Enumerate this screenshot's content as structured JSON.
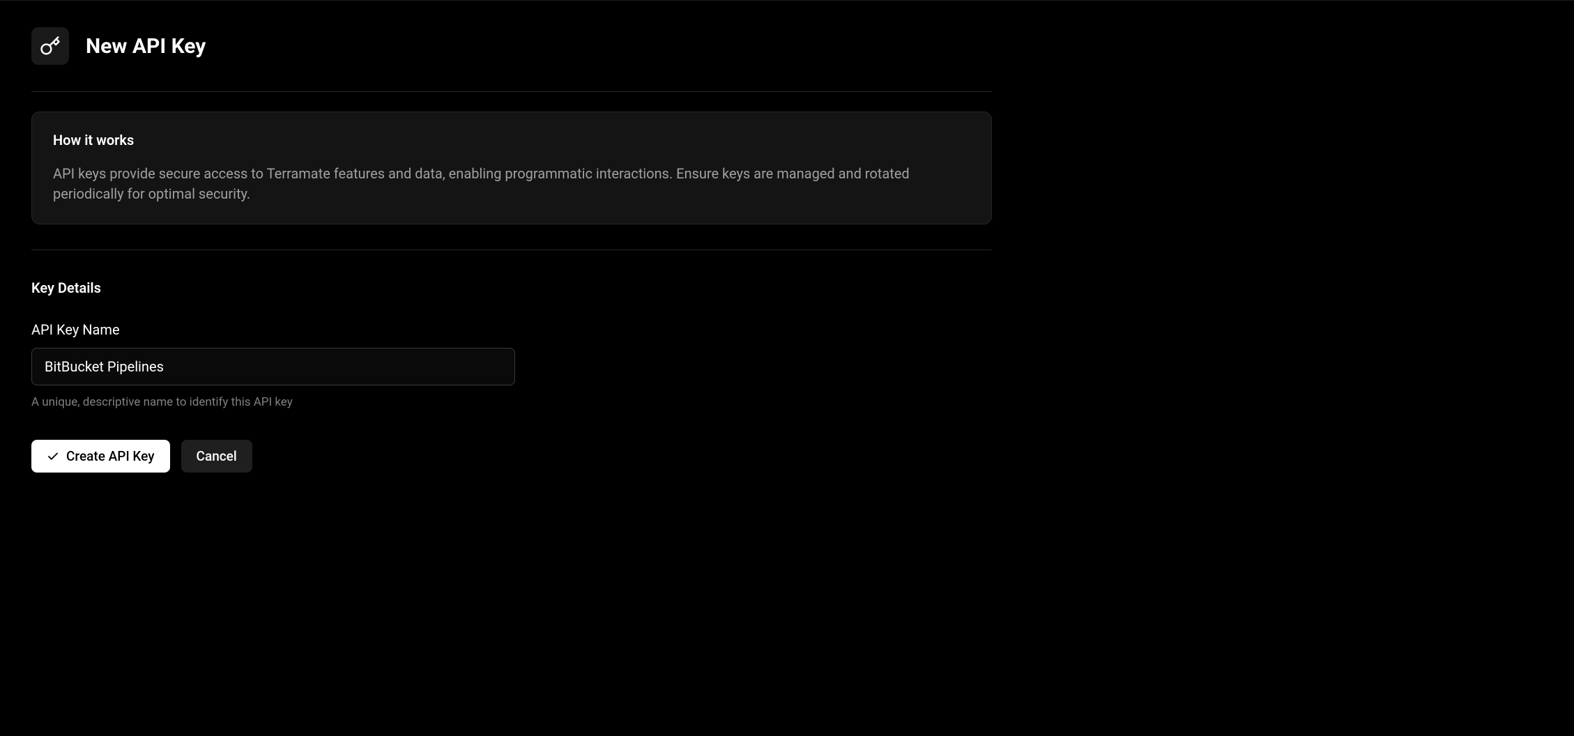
{
  "header": {
    "title": "New API Key"
  },
  "infoCard": {
    "title": "How it works",
    "text": "API keys provide secure access to Terramate features and data, enabling programmatic interactions. Ensure keys are managed and rotated periodically for optimal security."
  },
  "form": {
    "sectionTitle": "Key Details",
    "nameField": {
      "label": "API Key Name",
      "value": "BitBucket Pipelines",
      "hint": "A unique, descriptive name to identify this API key"
    },
    "buttons": {
      "create": "Create API Key",
      "cancel": "Cancel"
    }
  }
}
